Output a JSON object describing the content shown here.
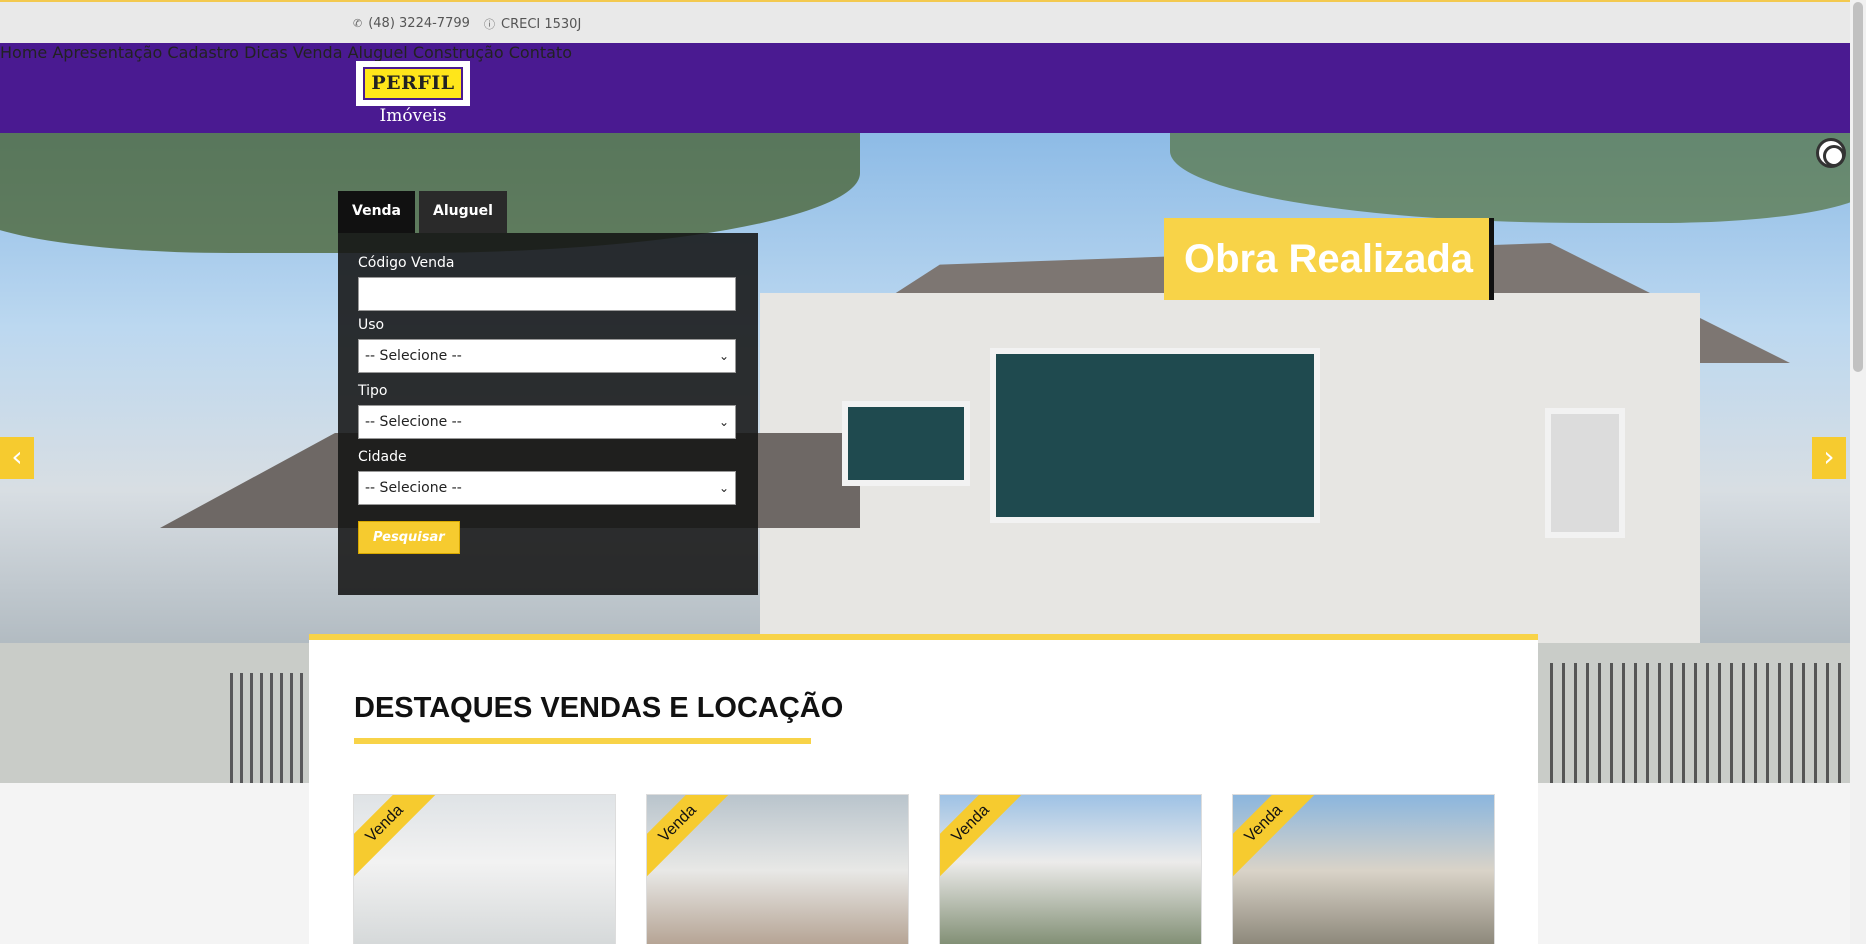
{
  "topbar": {
    "phone_icon": "phone-icon",
    "phone": "(48) 3224-7799",
    "info_icon": "info-icon",
    "creci": "CRECI 1530J"
  },
  "brand": {
    "logo_text": "PERFIL",
    "logo_sub": "Imóveis",
    "header_color": "#4a1a91",
    "accent_color": "#f8d348"
  },
  "nav": {
    "items": [
      "Home",
      "Apresentação",
      "Cadastro",
      "Dicas",
      "Venda",
      "Aluguel",
      "Construção",
      "Contato"
    ]
  },
  "hero": {
    "badge": "Obra Realizada",
    "prev_arrow": "‹",
    "next_arrow": "›"
  },
  "search": {
    "tabs": [
      "Venda",
      "Aluguel"
    ],
    "fields": {
      "codigo_label": "Código Venda",
      "codigo_value": "",
      "uso_label": "Uso",
      "uso_value": "-- Selecione --",
      "tipo_label": "Tipo",
      "tipo_value": "-- Selecione --",
      "cidade_label": "Cidade",
      "cidade_value": "-- Selecione --"
    },
    "button": "Pesquisar"
  },
  "featured": {
    "title": "DESTAQUES VENDAS E LOCAÇÃO",
    "cards": [
      {
        "ribbon": "Venda"
      },
      {
        "ribbon": "Venda"
      },
      {
        "ribbon": "Venda"
      },
      {
        "ribbon": "Venda"
      }
    ]
  }
}
